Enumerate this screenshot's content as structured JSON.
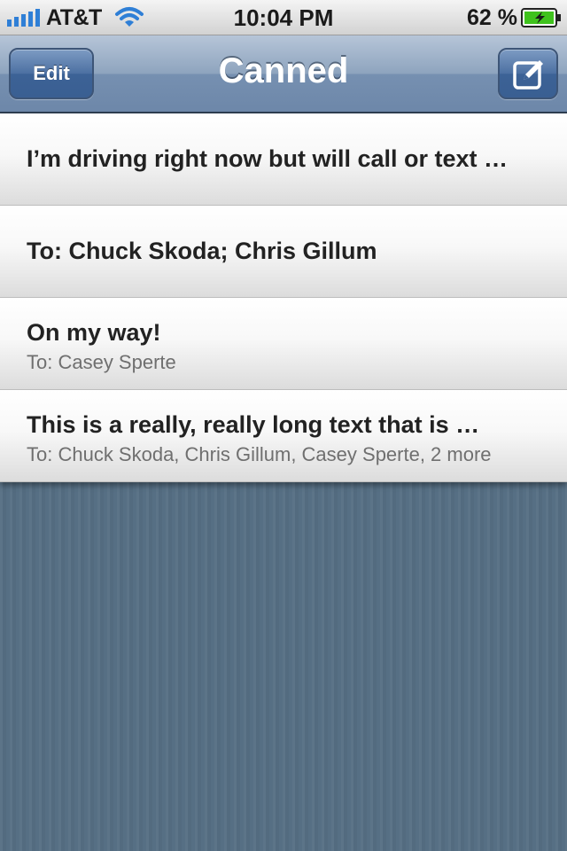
{
  "status_bar": {
    "carrier": "AT&T",
    "time": "10:04 PM",
    "battery": "62 %",
    "battery_level_percent": 62,
    "signal_bars": 5
  },
  "nav": {
    "title": "Canned",
    "edit_label": "Edit",
    "compose_icon": "compose-icon"
  },
  "messages": [
    {
      "title": "I’m driving right now but will call or text …",
      "subtitle": ""
    },
    {
      "title": "To: Chuck Skoda; Chris Gillum",
      "subtitle": ""
    },
    {
      "title": "On my way!",
      "subtitle": "To: Casey Sperte"
    },
    {
      "title": "This is a really, really long text that is …",
      "subtitle": "To: Chuck Skoda, Chris Gillum, Casey Sperte, 2 more"
    }
  ],
  "colors": {
    "nav_accent": "#6d87a9",
    "button": "#3c6296",
    "background": "#566f84",
    "battery_fill": "#3fc21d"
  }
}
